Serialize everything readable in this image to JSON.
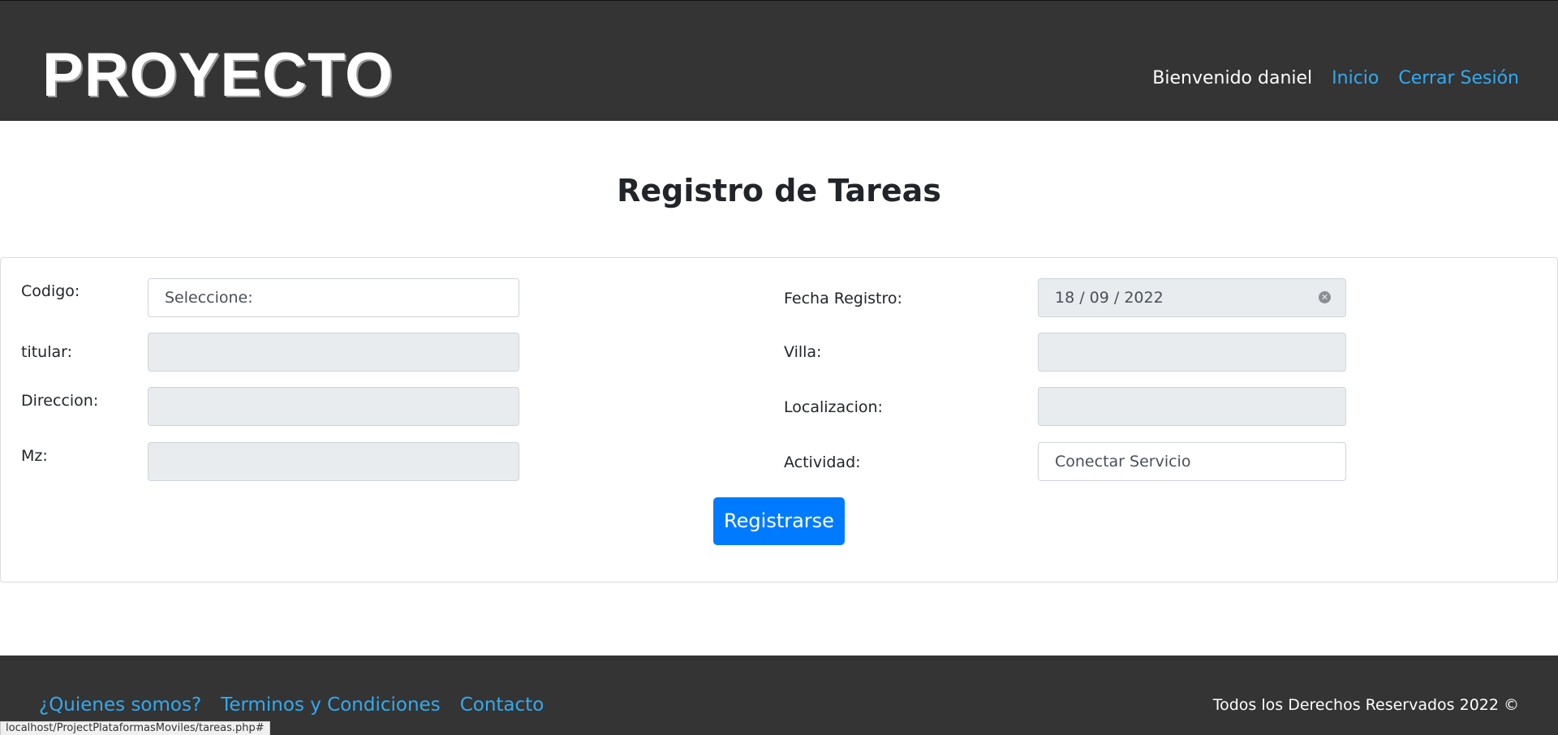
{
  "header": {
    "logo": "PROYECTO",
    "welcome": "Bienvenido daniel",
    "nav": [
      "Inicio",
      "Cerrar Sesión"
    ]
  },
  "page_title": "Registro de Tareas",
  "form": {
    "codigo": {
      "label": "Codigo:",
      "value": "Seleccione:"
    },
    "titular": {
      "label": "titular:",
      "value": ""
    },
    "direccion": {
      "label": "Direccion:",
      "value": ""
    },
    "mz": {
      "label": "Mz:",
      "value": ""
    },
    "fecha": {
      "label": "Fecha Registro:",
      "value": "18 / 09 / 2022"
    },
    "villa": {
      "label": "Villa:",
      "value": ""
    },
    "localizacion": {
      "label": "Localizacion:",
      "value": ""
    },
    "actividad": {
      "label": "Actividad:",
      "value": "Conectar Servicio"
    },
    "submit_label": "Registrarse"
  },
  "footer": {
    "links": [
      "¿Quienes somos?",
      "Terminos y Condiciones",
      "Contacto"
    ],
    "copyright": "Todos los Derechos Reservados 2022 ©"
  },
  "status_url": "localhost/ProjectPlataformasMoviles/tareas.php#",
  "colors": {
    "header_bg": "#343434",
    "link": "#33aaf0",
    "primary": "#007bff",
    "readonly_bg": "#e9ecef"
  },
  "icons": {
    "date_clear": "clear-circle-icon"
  }
}
